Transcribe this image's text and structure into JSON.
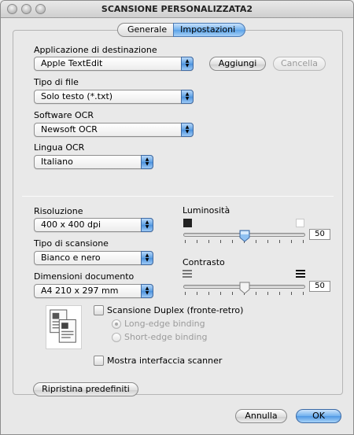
{
  "window": {
    "title": "SCANSIONE PERSONALIZZATA2"
  },
  "tabs": [
    {
      "label": "Generale",
      "active": false
    },
    {
      "label": "Impostazioni",
      "active": true
    }
  ],
  "destination_app": {
    "label": "Applicazione di destinazione",
    "value": "Apple TextEdit",
    "add_button": "Aggiungi",
    "delete_button": "Cancella"
  },
  "file_type": {
    "label": "Tipo di file",
    "value": "Solo testo (*.txt)"
  },
  "ocr_software": {
    "label": "Software OCR",
    "value": "Newsoft OCR"
  },
  "ocr_language": {
    "label": "Lingua OCR",
    "value": "Italiano"
  },
  "resolution": {
    "label": "Risoluzione",
    "value": "400 x 400 dpi"
  },
  "scan_type": {
    "label": "Tipo di scansione",
    "value": "Bianco e nero"
  },
  "document_size": {
    "label": "Dimensioni documento",
    "value": "A4  210 x 297 mm"
  },
  "brightness": {
    "label": "Luminosità",
    "value": "50",
    "level": 0.5
  },
  "contrast": {
    "label": "Contrasto",
    "value": "50",
    "level": 0.5
  },
  "duplex": {
    "label": "Scansione Duplex (fronte-retro)",
    "checked": false,
    "long_edge": "Long-edge binding",
    "short_edge": "Short-edge binding"
  },
  "show_scanner_interface": {
    "label": "Mostra interfaccia scanner",
    "checked": false
  },
  "buttons": {
    "restore": "Ripristina predefiniti",
    "cancel": "Annulla",
    "ok": "OK"
  },
  "colors": {
    "accent": "#5aa2e8",
    "window_bg": "#e8e8e8"
  }
}
